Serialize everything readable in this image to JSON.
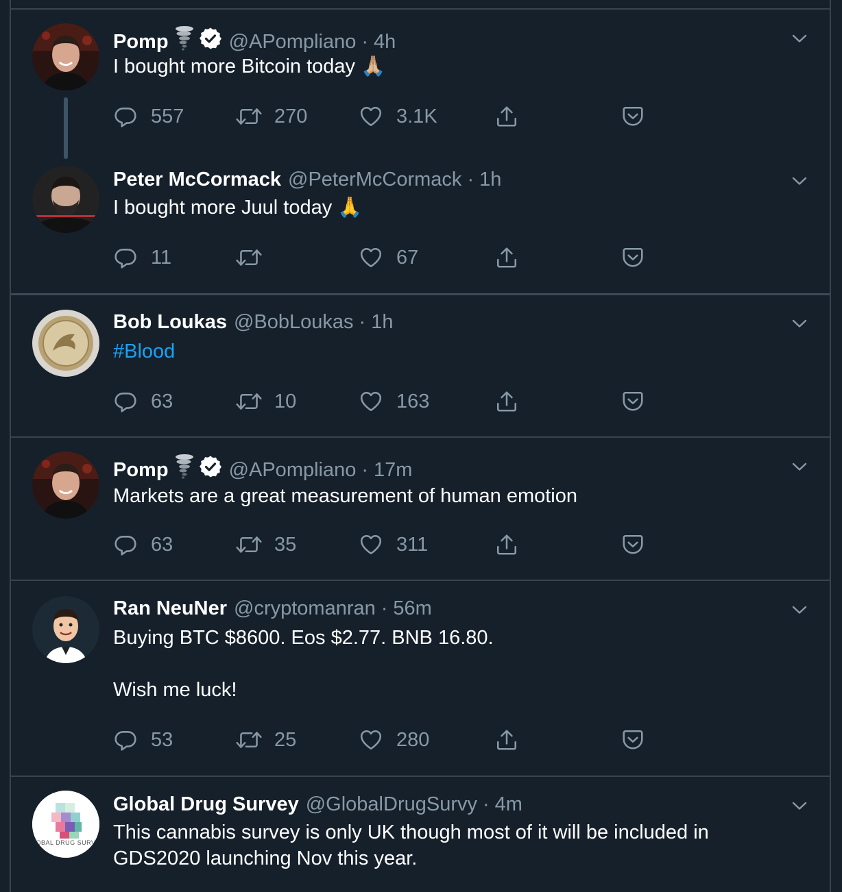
{
  "tweets": [
    {
      "name": "Pomp",
      "badge_emoji": "🌪",
      "verified": true,
      "handle": "@APompliano",
      "sep": "·",
      "time": "4h",
      "text": "I bought more Bitcoin today 🙏🏼",
      "replies": "557",
      "retweets": "270",
      "likes": "3.1K"
    },
    {
      "name": "Peter McCormack",
      "handle": "@PeterMcCormack",
      "sep": "·",
      "time": "1h",
      "text": "I bought more Juul today 🙏",
      "replies": "11",
      "retweets": "",
      "likes": "67"
    },
    {
      "name": "Bob Loukas",
      "handle": "@BobLoukas",
      "sep": "·",
      "time": "1h",
      "text": "#Blood",
      "replies": "63",
      "retweets": "10",
      "likes": "163"
    },
    {
      "name": "Pomp",
      "badge_emoji": "🌪",
      "verified": true,
      "handle": "@APompliano",
      "sep": "·",
      "time": "17m",
      "text": "Markets are a great measurement of human emotion",
      "replies": "63",
      "retweets": "35",
      "likes": "311"
    },
    {
      "name": "Ran NeuNer",
      "handle": "@cryptomanran",
      "sep": "·",
      "time": "56m",
      "text_line1": "Buying BTC $8600. Eos $2.77. BNB 16.80.",
      "text_line2": "Wish me luck!",
      "replies": "53",
      "retweets": "25",
      "likes": "280"
    },
    {
      "name": "Global Drug Survey",
      "handle": "@GlobalDrugSurvy",
      "sep": "·",
      "time": "4m",
      "text_line1": "This cannabis survey is only UK though most of it will be included in",
      "text_line2": "GDS2020 launching Nov this year.",
      "avatar_text": "OBAL DRUG SURV"
    }
  ],
  "colors": {
    "background": "#15202b",
    "border": "#38444d",
    "secondary_text": "#8899a6",
    "hashtag": "#1da1f2"
  },
  "icons": [
    "reply-icon",
    "retweet-icon",
    "like-icon",
    "share-icon",
    "save-icon",
    "caret-down-icon",
    "verified-badge-icon"
  ]
}
